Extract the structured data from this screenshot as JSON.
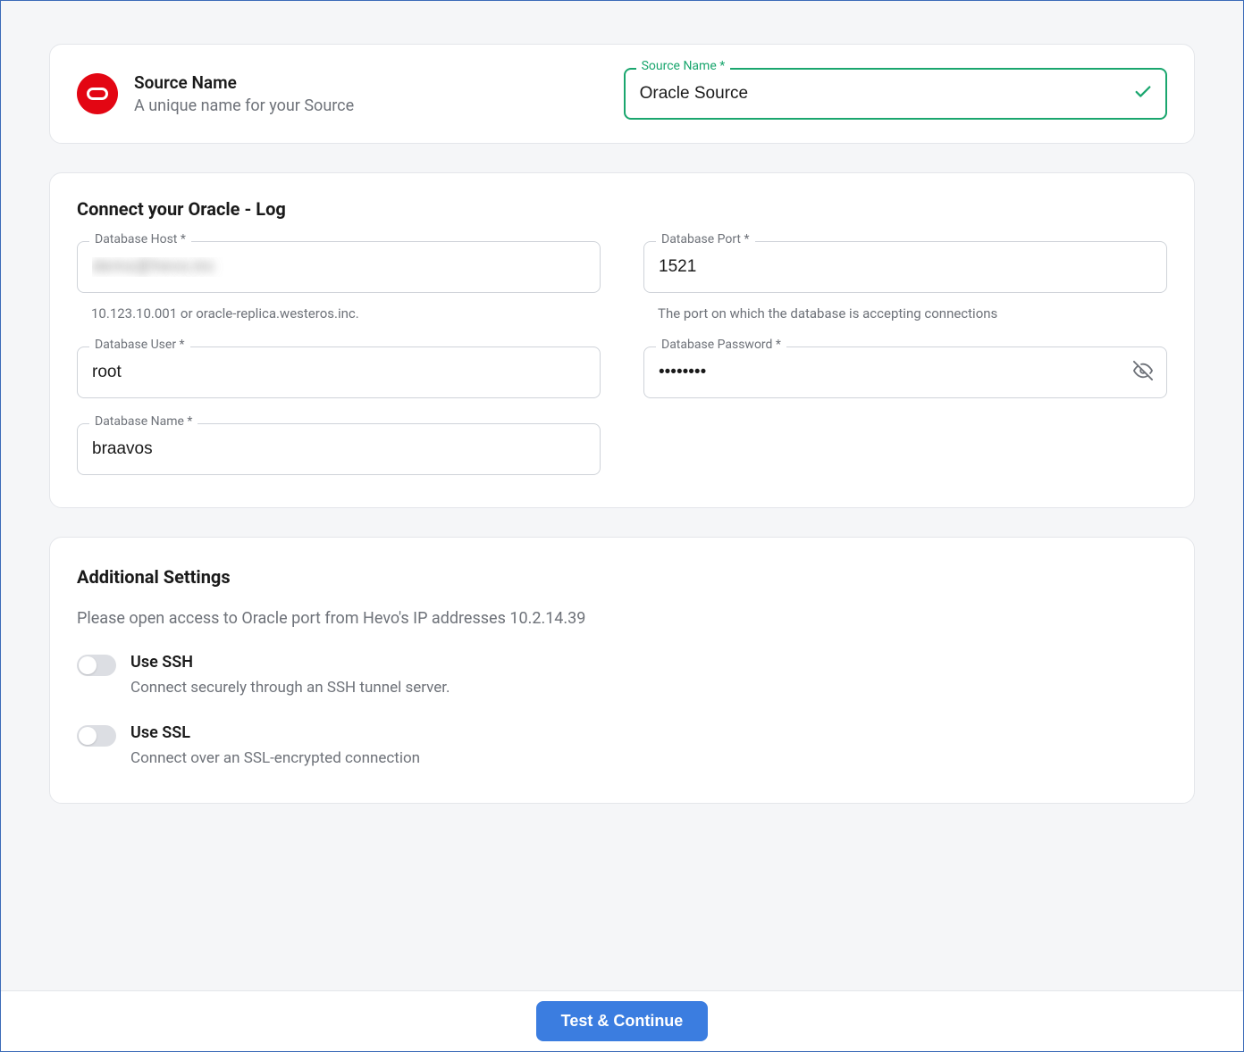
{
  "source_section": {
    "title": "Source Name",
    "description": "A unique name for your Source",
    "field_label": "Source Name *",
    "field_value": "Oracle Source"
  },
  "connect_section": {
    "title": "Connect your Oracle - Log",
    "fields": {
      "host": {
        "label": "Database Host *",
        "value": "demo@hevo.inc",
        "helper": "10.123.10.001 or oracle-replica.westeros.inc."
      },
      "port": {
        "label": "Database Port *",
        "value": "1521",
        "helper": "The port on which the database is accepting connections"
      },
      "user": {
        "label": "Database User *",
        "value": "root"
      },
      "password": {
        "label": "Database Password *",
        "value": "••••••••"
      },
      "dbname": {
        "label": "Database Name *",
        "value": "braavos"
      }
    }
  },
  "additional_section": {
    "title": "Additional Settings",
    "description": "Please open access to Oracle port from Hevo's IP addresses 10.2.14.39",
    "toggles": {
      "ssh": {
        "label": "Use SSH",
        "desc": "Connect securely through an SSH tunnel server."
      },
      "ssl": {
        "label": "Use SSL",
        "desc": "Connect over an SSL-encrypted connection"
      }
    }
  },
  "footer": {
    "button_label": "Test & Continue"
  }
}
